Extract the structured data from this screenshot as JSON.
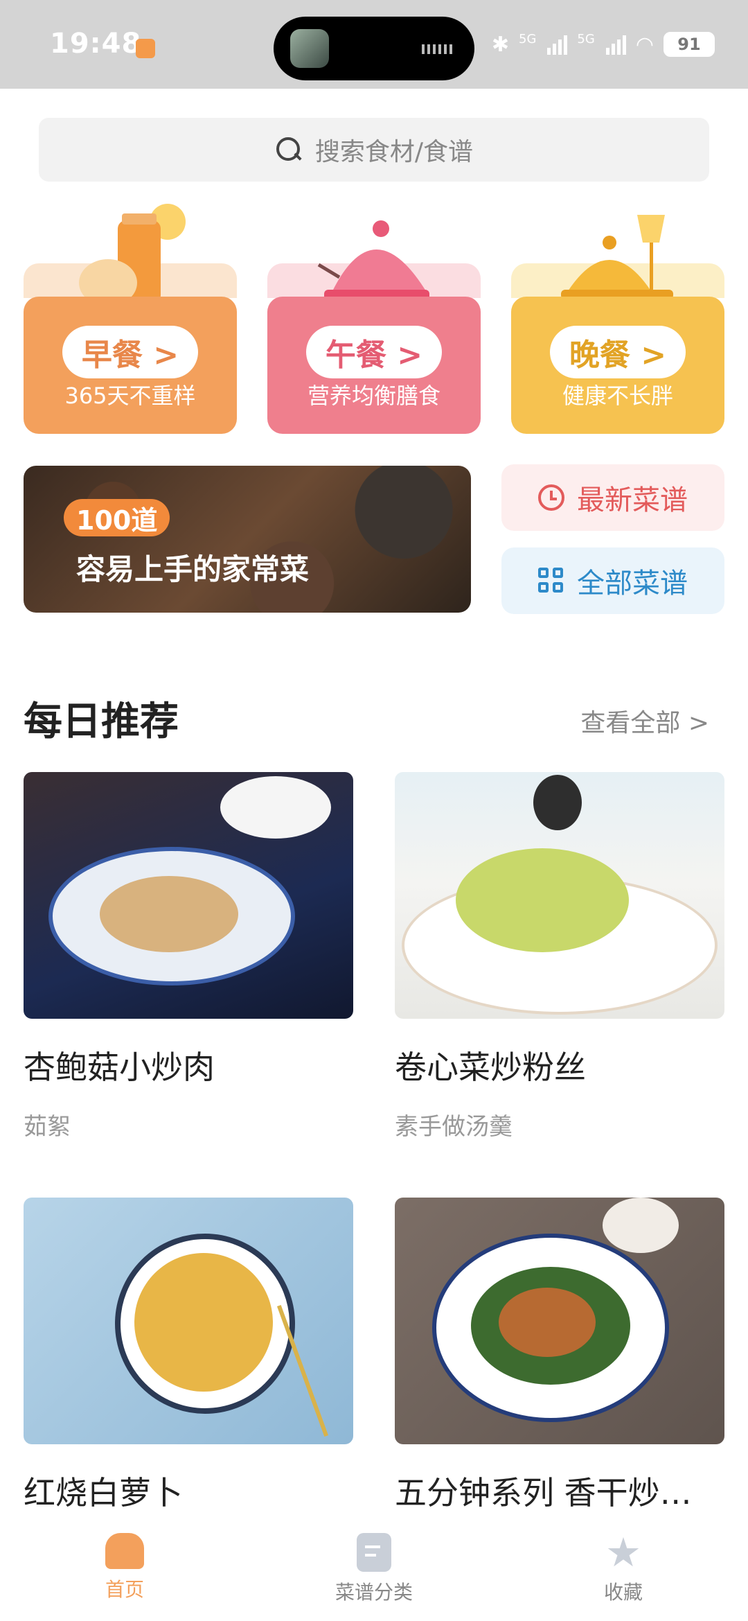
{
  "status_bar": {
    "time": "19:48",
    "battery": "91",
    "network_1": "5G",
    "network_2": "5G"
  },
  "search": {
    "placeholder": "搜索食材/食谱"
  },
  "meals": [
    {
      "label": "早餐 >",
      "subtitle": "365天不重样"
    },
    {
      "label": "午餐 >",
      "subtitle": "营养均衡膳食"
    },
    {
      "label": "晚餐 >",
      "subtitle": "健康不长胖"
    }
  ],
  "banner": {
    "badge": "100道",
    "title": "容易上手的家常菜"
  },
  "quick_links": {
    "latest": "最新菜谱",
    "all": "全部菜谱"
  },
  "daily": {
    "title": "每日推荐",
    "see_all": "查看全部 >",
    "recipes": [
      {
        "name": "杏鲍菇小炒肉",
        "author": "茹絮"
      },
      {
        "name": "卷心菜炒粉丝",
        "author": "素手做汤羹"
      },
      {
        "name": "红烧白萝卜",
        "author": ""
      },
      {
        "name": "五分钟系列 香干炒…",
        "author": ""
      }
    ]
  },
  "tabs": {
    "home": "首页",
    "category": "菜谱分类",
    "favorites": "收藏"
  },
  "colors": {
    "accent": "#f3a05c",
    "breakfast": "#f3a05c",
    "lunch": "#ef7f8d",
    "dinner": "#f6c250"
  }
}
